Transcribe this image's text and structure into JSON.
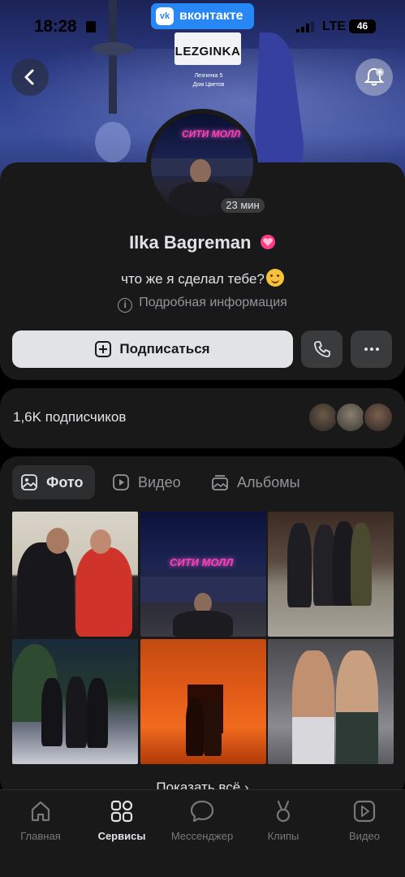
{
  "status_bar": {
    "time": "18:28",
    "app_pill": "вконтакте",
    "app_pill_logo": "vk",
    "network": "LTE",
    "battery": "46"
  },
  "cover": {
    "sign_text": "LEZGINKA",
    "sign_sub": "Лезгинка 5",
    "sign_sub2": "Дом Цветов"
  },
  "profile": {
    "name": "Ilka Bagreman",
    "online": "23 мин",
    "status": "что же я сделал тебе?",
    "more_info": "Подробная информация",
    "subscribe_label": "Подписаться",
    "avatar_neon": "СИТИ МОЛЛ"
  },
  "followers": {
    "count_label": "1,6K подписчиков"
  },
  "media": {
    "tabs": [
      {
        "label": "Фото",
        "icon": "photo-icon",
        "active": true
      },
      {
        "label": "Видео",
        "icon": "video-icon",
        "active": false
      },
      {
        "label": "Альбомы",
        "icon": "albums-icon",
        "active": false
      }
    ],
    "photo2_neon": "СИТИ МОЛЛ",
    "show_all": "Показать всё ›"
  },
  "tabbar": {
    "items": [
      {
        "label": "Главная",
        "icon": "home-icon",
        "active": false
      },
      {
        "label": "Сервисы",
        "icon": "services-icon",
        "active": true
      },
      {
        "label": "Мессенджер",
        "icon": "messenger-icon",
        "active": false
      },
      {
        "label": "Клипы",
        "icon": "clips-icon",
        "active": false
      },
      {
        "label": "Видео",
        "icon": "video-icon",
        "active": false
      }
    ]
  },
  "colors": {
    "background": "#000000",
    "card": "#19191a",
    "text_primary": "#e1e3e6",
    "text_secondary": "#939599",
    "vk_blue": "#2787f5",
    "button_light": "#e1e3e6",
    "button_dark": "#3a3b3d"
  }
}
